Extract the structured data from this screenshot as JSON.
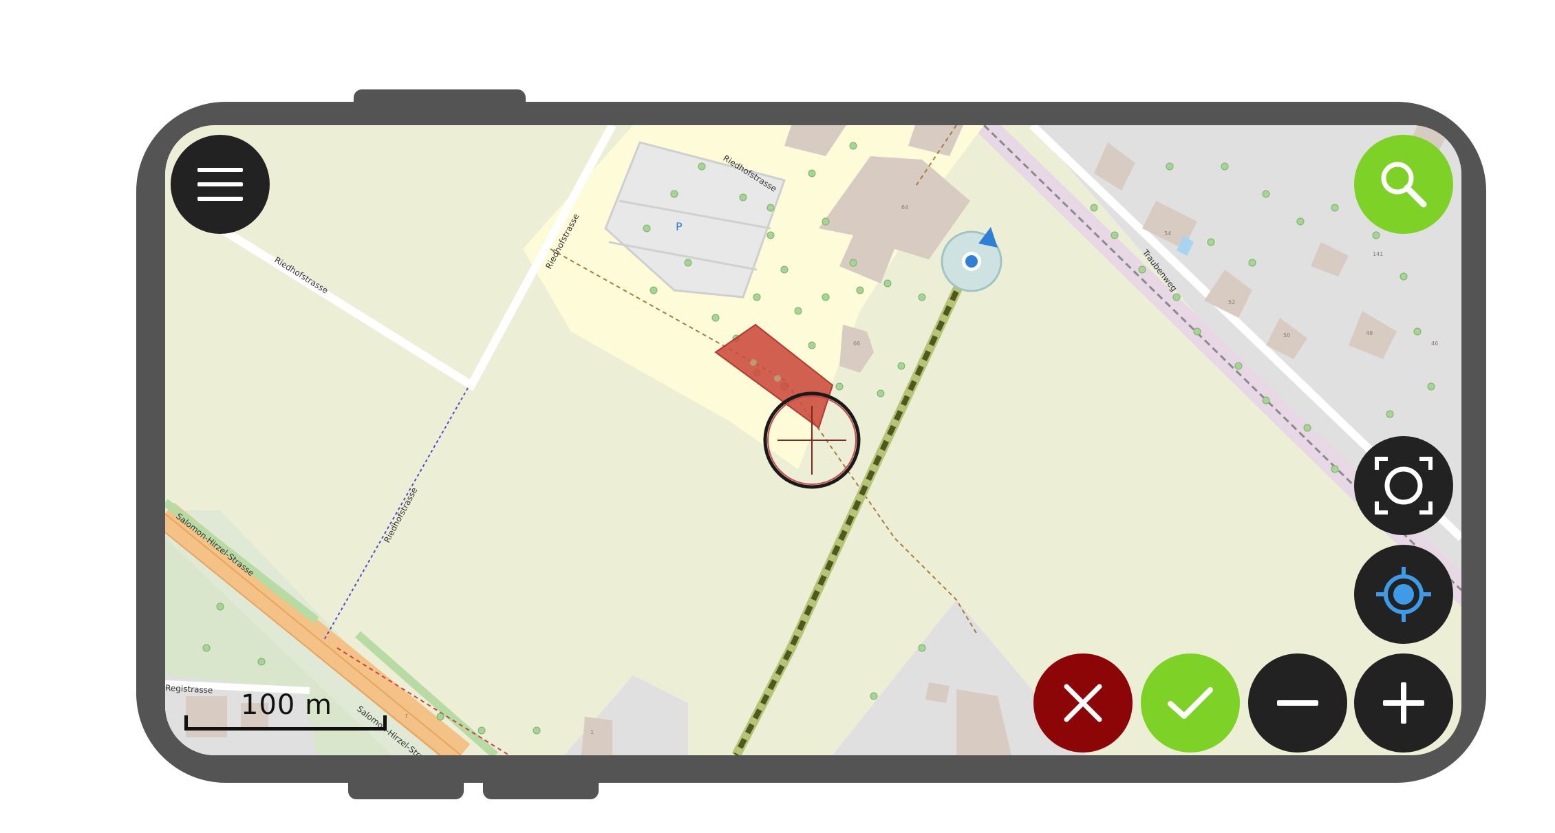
{
  "map": {
    "scale_label": "100 m",
    "streets": [
      "Riedhofstrasse",
      "Riedhofstrasse",
      "Riedhofstrasse",
      "Riedhofstrasse",
      "Traubenweg",
      "Salomon-Hirzel-Strasse",
      "Salomon-Hirzel-Strasse",
      "Registrasse"
    ],
    "parking_label": "P",
    "house_numbers": [
      "64",
      "66",
      "54",
      "52",
      "50",
      "48",
      "46",
      "141",
      "1",
      "7"
    ]
  },
  "buttons": {
    "menu": "menu-icon",
    "search": "search-icon",
    "zoom_extent": "zoom-extent-icon",
    "locate": "gps-locate-icon",
    "cancel": "close-icon",
    "confirm": "check-icon",
    "zoom_out": "minus-icon",
    "zoom_in": "plus-icon"
  },
  "colors": {
    "frame": "#555454",
    "map_background": "#ecefd6",
    "dark_button": "#222222",
    "accent_green": "#7ed126",
    "cancel_red": "#8c0607",
    "selection_fill": "#cc4a3c",
    "gps_blue": "#2f7fd6"
  }
}
